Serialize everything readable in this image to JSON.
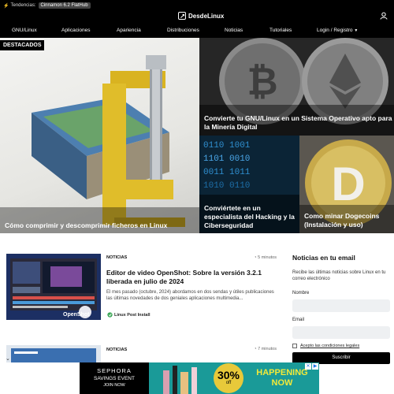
{
  "topbar": {
    "trending_label": "Tendencias:",
    "trending_tag": "Cinnamon 6.2 FlatHub",
    "logo_text": "DesdeLinux"
  },
  "nav": {
    "items": [
      "GNU/Linux",
      "Aplicaciones",
      "Apariencia",
      "Distribuciones",
      "Noticias",
      "Tutoriales",
      "Login / Registro"
    ]
  },
  "hero": {
    "badge": "DESTACADOS",
    "main_caption": "Cómo comprimir y descomprimir ficheros en Linux",
    "top_right_caption": "Convierte tu GNU/Linux en un Sistema Operativo apto para la Minería Digital",
    "bottom_mid_caption": "Conviértete en un especialista del Hacking y la Ciberseguridad",
    "bottom_right_caption": "Como minar Dogecoins (Instalación y uso)"
  },
  "articles": [
    {
      "category": "NOTICIAS",
      "read_time": "5 minutos",
      "title": "Editor de video OpenShot: Sobre la versión 3.2.1 liberada en julio de 2024",
      "excerpt": "El mes pasado (octubre, 2024) abordamos en dos sendas y útiles publicaciones las últimas novedades de dos geniales aplicaciones multimedia...",
      "source": "Linux Post Install"
    },
    {
      "category": "NOTICIAS",
      "read_time": "7 minutos"
    }
  ],
  "newsletter": {
    "title": "Noticias en tu email",
    "description": "Recibe las últimas noticias sobre Linux en tu correo electrónico",
    "name_label": "Nombre",
    "email_label": "Email",
    "terms_label": "Acepto las condiciones legales",
    "submit_label": "Suscribir"
  },
  "ad": {
    "brand": "SEPHORA",
    "line1": "SAVINGS EVENT",
    "line2": "JOIN NOW",
    "discount": "30%",
    "discount_suffix": "off",
    "headline1": "HAPPENING",
    "headline2": "NOW"
  },
  "colors": {
    "topbar_bg": "#000000",
    "ad_bg": "#1a9a98",
    "ad_headline": "#f2e93a",
    "discount_circle": "#e8c93a"
  }
}
